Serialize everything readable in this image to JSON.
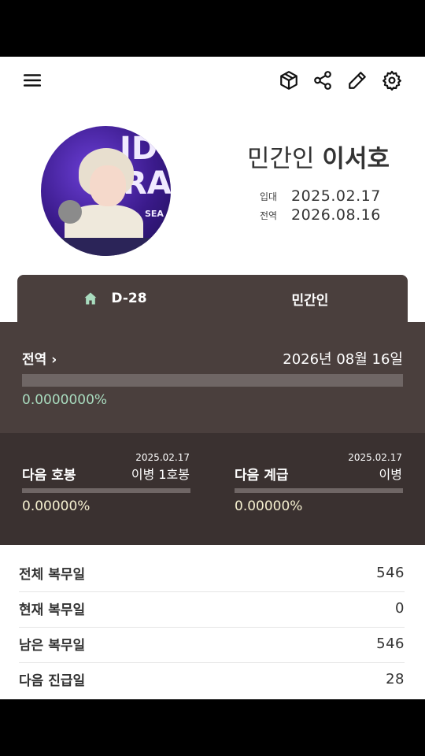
{
  "toolbar": {
    "icons": [
      "menu-icon",
      "package-icon",
      "share-icon",
      "edit-icon",
      "settings-icon"
    ]
  },
  "profile": {
    "avatar_text_line1": "ID",
    "avatar_text_line2": "RAI",
    "avatar_text_line3": "SEA",
    "status_prefix": "민간인",
    "name": "이서호",
    "enlist_label": "입대",
    "enlist_date": "2025.02.17",
    "discharge_label": "전역",
    "discharge_date": "2026.08.16"
  },
  "tabs": {
    "dday": "D-28",
    "status": "민간인"
  },
  "discharge_panel": {
    "label": "전역 ›",
    "date": "2026년 08월 16일",
    "percent": "0.0000000%",
    "progress": 0.0
  },
  "next_panels": {
    "pay_grade": {
      "label": "다음 호봉",
      "date": "2025.02.17",
      "value": "이병 1호봉",
      "percent": "0.00000%",
      "progress": 0.0
    },
    "rank": {
      "label": "다음 계급",
      "date": "2025.02.17",
      "value": "이병",
      "percent": "0.00000%",
      "progress": 0.0
    }
  },
  "stats": [
    {
      "label": "전체 복무일",
      "value": "546"
    },
    {
      "label": "현재 복무일",
      "value": "0"
    },
    {
      "label": "남은 복무일",
      "value": "546"
    },
    {
      "label": "다음 진급일",
      "value": "28"
    }
  ],
  "colors": {
    "panel_dark": "#4a3f3d",
    "panel_darker": "#3a3130",
    "accent_green": "#a9dcbf",
    "accent_cream": "#f4efcf"
  }
}
